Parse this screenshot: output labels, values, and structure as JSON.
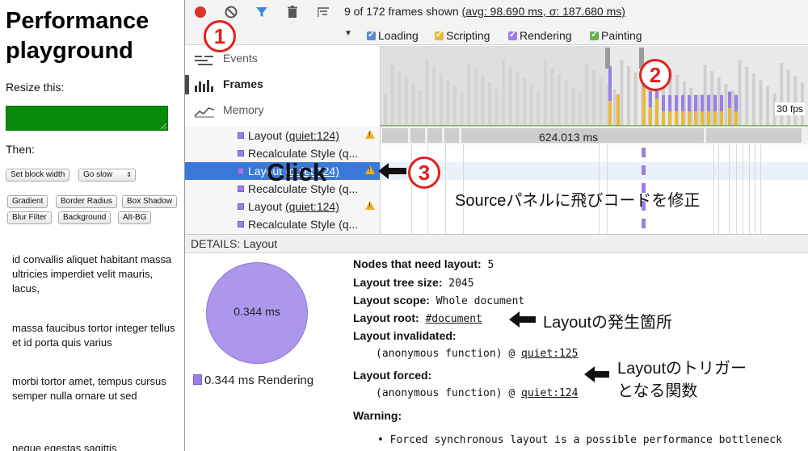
{
  "page": {
    "title": "Performance playground",
    "resize_label": "Resize this:",
    "then_label": "Then:",
    "buttons": {
      "set_block_width": "Set block width",
      "go_slow": "Go slow",
      "gradient": "Gradient",
      "border_radius": "Border Radius",
      "box_shadow": "Box Shadow",
      "blur_filter": "Blur Filter",
      "background": "Background",
      "alt_bg": "Alt-BG"
    },
    "paragraphs": [
      "id convallis aliquet habitant massa ultricies imperdiet velit mauris, lacus,",
      "massa faucibus tortor integer tellus et id porta quis varius",
      "morbi tortor amet, tempus cursus semper nulla ornare ut sed",
      "neque egestas sagittis"
    ]
  },
  "toolbar": {
    "frames_shown": "9 of 172 frames shown",
    "avg": "(avg: 98.690 ms, σ: 187.680 ms)"
  },
  "filters": [
    {
      "label": "Loading",
      "color": "#5b8ad5"
    },
    {
      "label": "Scripting",
      "color": "#e8b93a"
    },
    {
      "label": "Rendering",
      "color": "#9b7fe6"
    },
    {
      "label": "Painting",
      "color": "#6ab04c"
    }
  ],
  "nav": {
    "events": "Events",
    "frames": "Frames",
    "memory": "Memory"
  },
  "overview": {
    "fps_label": "30 fps"
  },
  "tree": {
    "rows": [
      {
        "name": "Layout",
        "link": "(quiet:124)",
        "warning": true,
        "selected": false
      },
      {
        "name": "Recalculate Style",
        "link": "(q...",
        "warning": false,
        "selected": false
      },
      {
        "name": "Layout",
        "link": "(quiet:124)",
        "warning": true,
        "selected": true
      },
      {
        "name": "Recalculate Style",
        "link": "(q...",
        "warning": false,
        "selected": false
      },
      {
        "name": "Layout",
        "link": "(quiet:124)",
        "warning": true,
        "selected": false
      },
      {
        "name": "Recalculate Style",
        "link": "(q...",
        "warning": false,
        "selected": false
      }
    ]
  },
  "flame": {
    "duration": "624.013 ms"
  },
  "details": {
    "header": "DETAILS: Layout",
    "pie_value": "0.344 ms",
    "legend": "0.344 ms Rendering",
    "nodes_label": "Nodes that need layout:",
    "nodes_value": "5",
    "tree_size_label": "Layout tree size:",
    "tree_size_value": "2045",
    "scope_label": "Layout scope:",
    "scope_value": "Whole document",
    "root_label": "Layout root:",
    "root_value": "#document",
    "invalidated_label": "Layout invalidated:",
    "invalidated_fn": "(anonymous function) @ ",
    "invalidated_link": "quiet:125",
    "forced_label": "Layout forced:",
    "forced_fn": "(anonymous function) @ ",
    "forced_link": "quiet:124",
    "warning_label": "Warning:",
    "warning_text": "• Forced synchronous layout is a possible performance bottleneck"
  },
  "annotations": {
    "n1": "1",
    "n2": "2",
    "n3": "3",
    "click": "Click",
    "source_note": "Sourceパネルに飛びコードを修正",
    "layout_site": "Layoutの発生箇所",
    "trigger_line1": "Layoutのトリガー",
    "trigger_line2": "となる関数",
    "accent": "#e3201b"
  }
}
